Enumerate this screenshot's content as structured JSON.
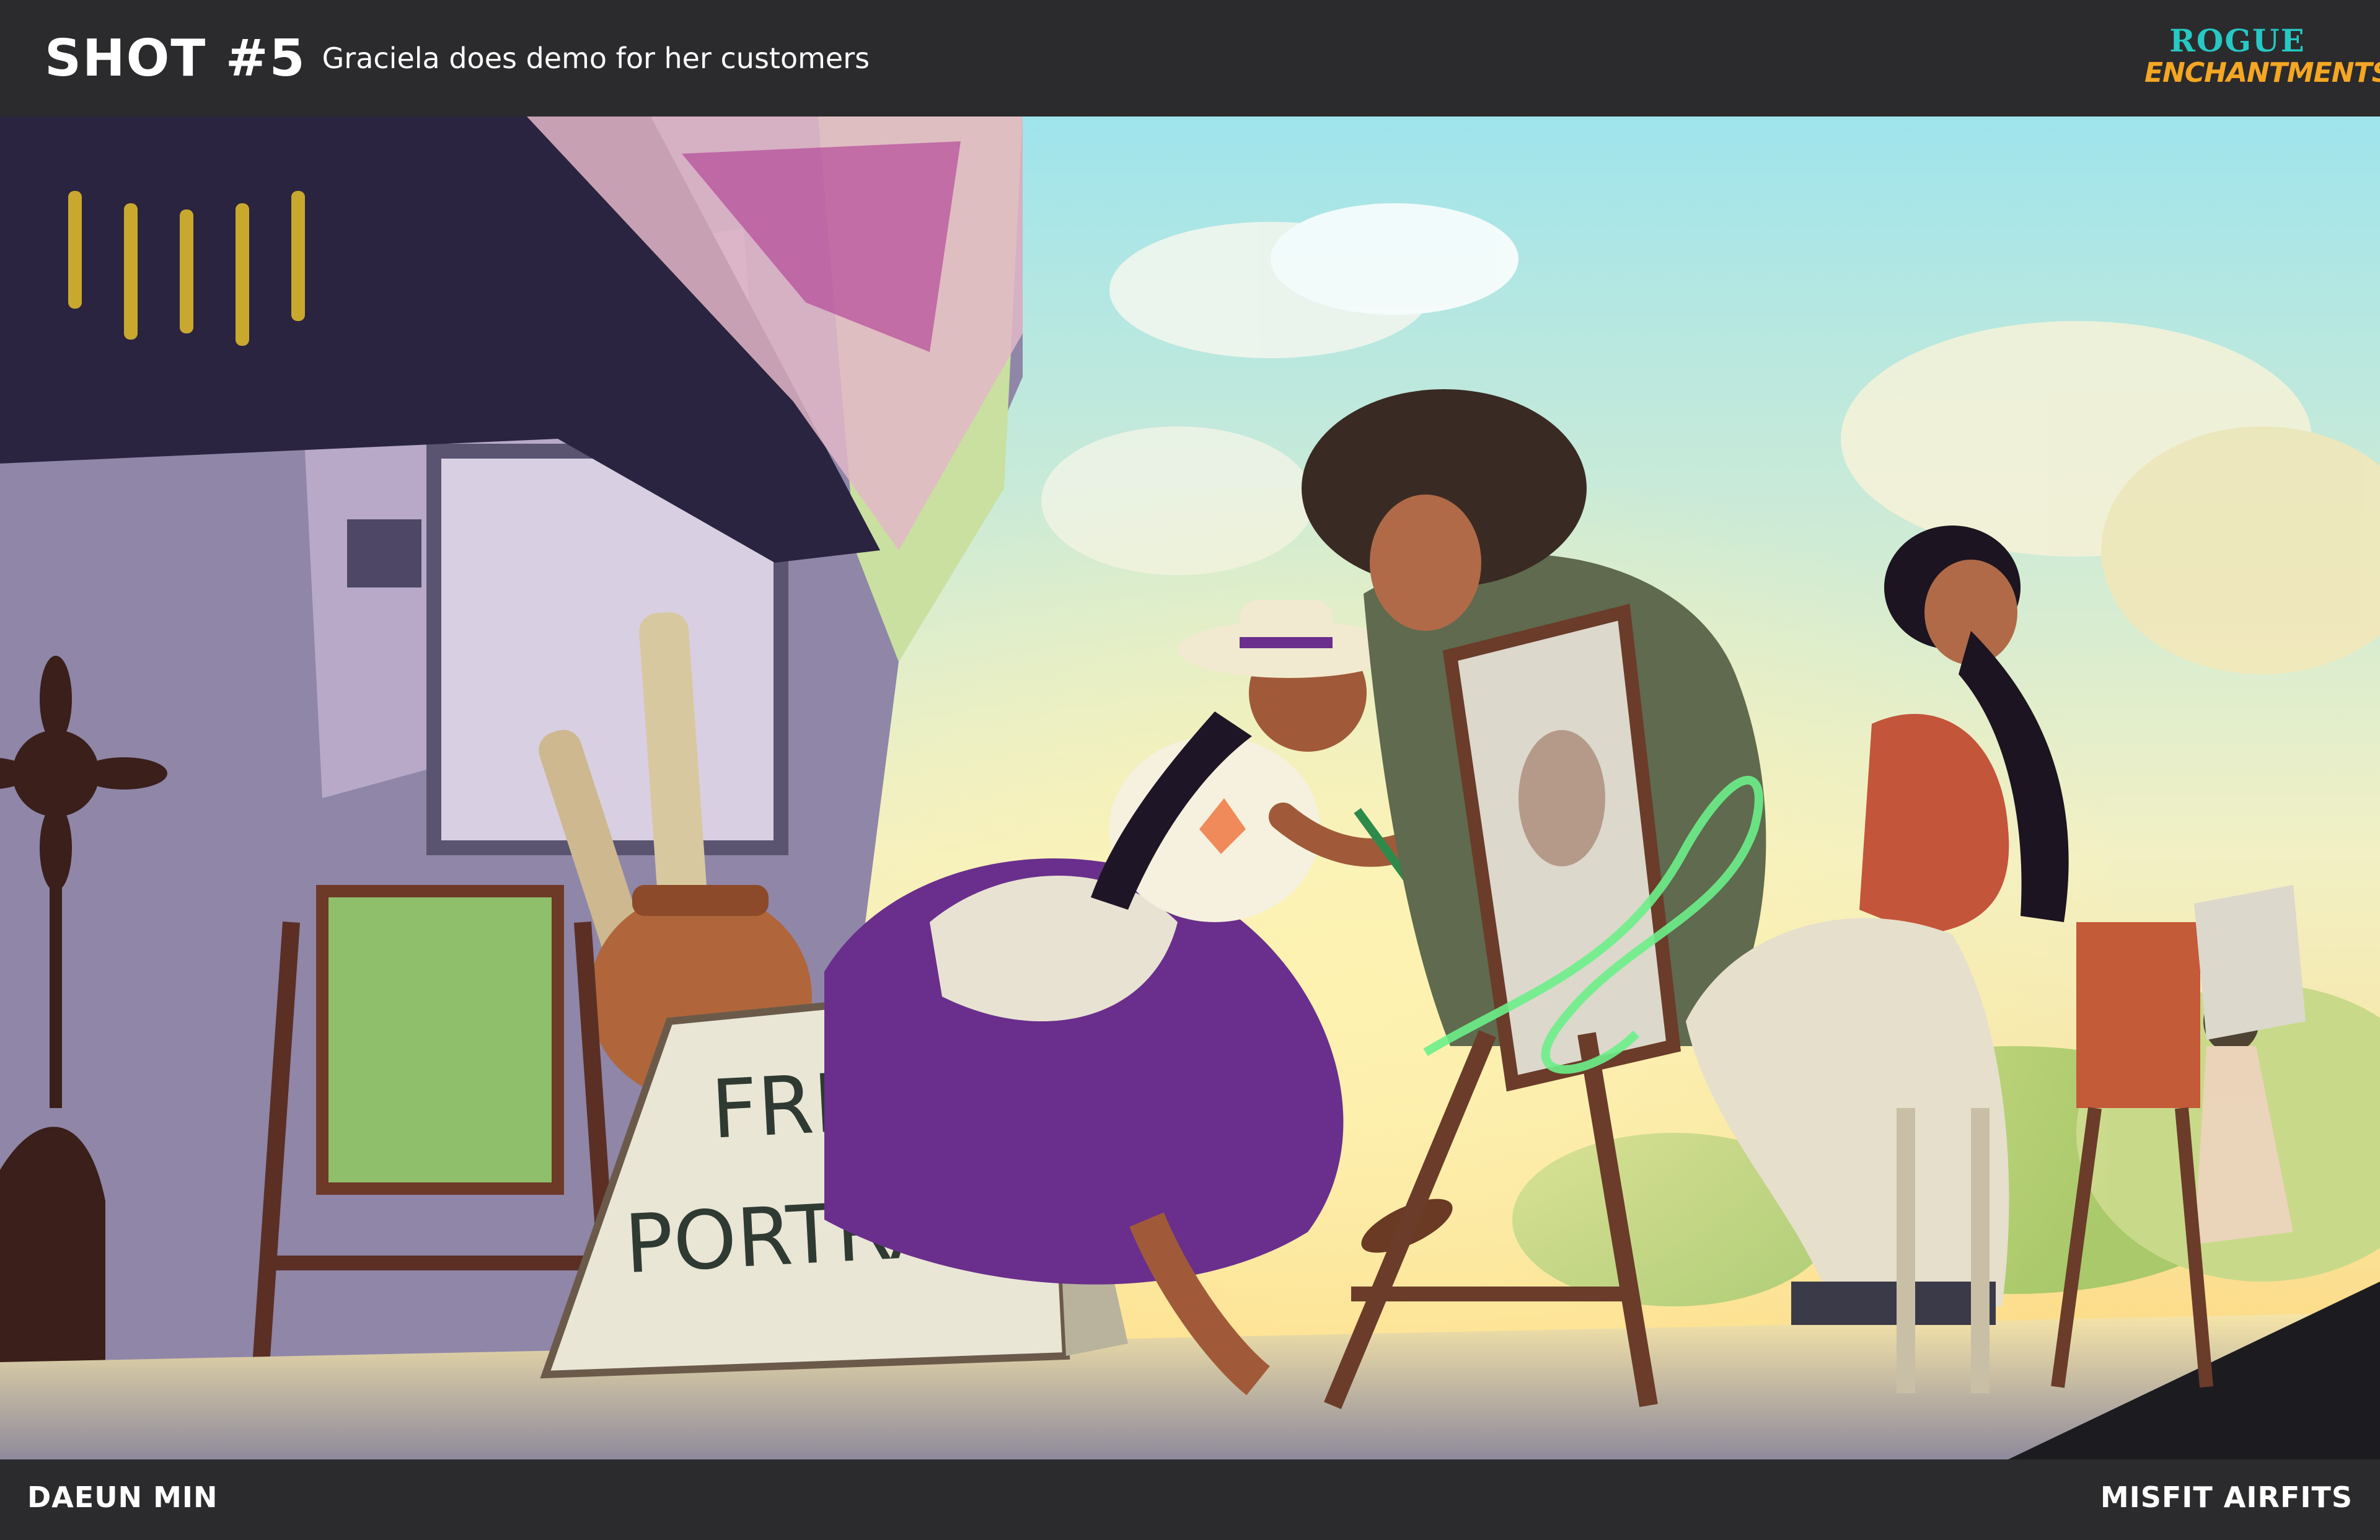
{
  "header": {
    "shot_number": "SHOT #5",
    "shot_description": "Graciela does demo for her customers",
    "logo_line1": "ROGUE",
    "logo_line2": "ENCHANTMENTS"
  },
  "artwork": {
    "sign_line1": "FREE",
    "sign_line2": "PORTRAIT",
    "colors": {
      "sky": "#aee3ea",
      "sunlight": "#ffe58a",
      "skirt": "#6a2f8c",
      "awning": "#2a2440",
      "magic": "#6cf08a"
    }
  },
  "footer": {
    "artist": "DAEUN MIN",
    "project": "MISFIT AIRFITS"
  }
}
